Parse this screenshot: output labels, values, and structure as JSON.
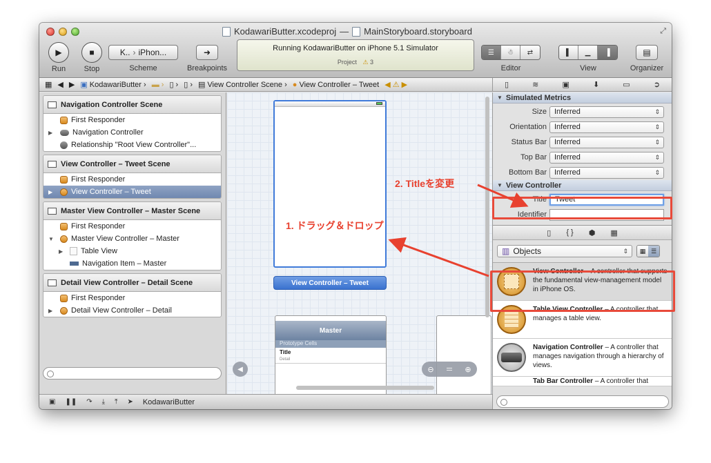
{
  "window": {
    "title_project": "KodawariButter.xcodeproj",
    "title_sep": "—",
    "title_file": "MainStoryboard.storyboard"
  },
  "toolbar": {
    "run_label": "Run",
    "stop_label": "Stop",
    "scheme_label": "Scheme",
    "scheme_target": "K..",
    "scheme_device": "iPhon...",
    "breakpoints_label": "Breakpoints",
    "editor_label": "Editor",
    "view_label": "View",
    "organizer_label": "Organizer"
  },
  "activity": {
    "status": "Running KodawariButter on iPhone 5.1 Simulator",
    "project": "Project",
    "warning_count": "3"
  },
  "jumpbar": {
    "items": [
      "KodawariButter",
      "View Controller Scene",
      "View Controller – Tweet"
    ]
  },
  "scenes": [
    {
      "title": "Navigation Controller Scene",
      "rows": [
        "First Responder",
        "Navigation Controller",
        "Relationship \"Root View Controller\"..."
      ]
    },
    {
      "title": "View Controller – Tweet Scene",
      "rows": [
        "First Responder",
        "View Controller – Tweet"
      ]
    },
    {
      "title": "Master View Controller – Master Scene",
      "rows": [
        "First Responder",
        "Master View Controller – Master",
        "Table View",
        "Navigation Item – Master"
      ]
    },
    {
      "title": "Detail View Controller – Detail Scene",
      "rows": [
        "First Responder",
        "Detail View Controller – Detail"
      ]
    }
  ],
  "canvas": {
    "vc_label": "View Controller – Tweet",
    "master_title": "Master",
    "prototype_cells": "Prototype Cells",
    "cell_title": "Title",
    "cell_detail": "Detail"
  },
  "bottombar": {
    "process": "KodawariButter"
  },
  "inspector": {
    "simulated_metrics": "Simulated Metrics",
    "metrics": [
      {
        "label": "Size",
        "value": "Inferred"
      },
      {
        "label": "Orientation",
        "value": "Inferred"
      },
      {
        "label": "Status Bar",
        "value": "Inferred"
      },
      {
        "label": "Top Bar",
        "value": "Inferred"
      },
      {
        "label": "Bottom Bar",
        "value": "Inferred"
      }
    ],
    "view_controller": "View Controller",
    "title_label": "Title",
    "title_value": "Tweet",
    "identifier_label": "Identifier"
  },
  "library": {
    "selector": "Objects",
    "items": [
      {
        "name": "View Controller",
        "desc": " – A controller that supports the fundamental view-management model in iPhone OS."
      },
      {
        "name": "Table View Controller",
        "desc": " – A controller that manages a table view."
      },
      {
        "name": "Navigation Controller",
        "desc": " – A controller that manages navigation through a hierarchy of views."
      },
      {
        "name": "Tab Bar Controller",
        "desc": " – A controller that"
      }
    ]
  },
  "annotations": {
    "step1": "1. ドラッグ＆ドロップ",
    "step2": "2. Titleを変更"
  },
  "colors": {
    "annotation": "#e8412f",
    "selection": "#7088b0",
    "canvas_selection": "#3f7ad9"
  }
}
